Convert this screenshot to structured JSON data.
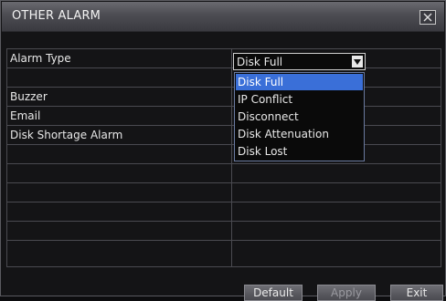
{
  "window": {
    "title": "OTHER ALARM"
  },
  "alarm_type": {
    "label": "Alarm Type",
    "selected": "Disk Full",
    "options": [
      "Disk Full",
      "IP Conflict",
      "Disconnect",
      "Disk Attenuation",
      "Disk Lost"
    ]
  },
  "rows": {
    "buzzer": "Buzzer",
    "email": "Email",
    "disk_shortage": "Disk Shortage Alarm"
  },
  "buttons": {
    "default": "Default",
    "apply": "Apply",
    "exit": "Exit"
  },
  "colors": {
    "highlight": "#3a6fd8",
    "title_bar": "#4c4c52",
    "background": "#141416"
  }
}
